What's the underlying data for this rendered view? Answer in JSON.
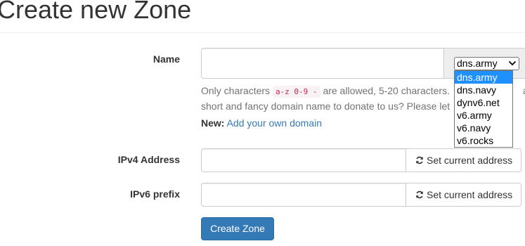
{
  "page": {
    "title": "Create new Zone"
  },
  "form": {
    "name": {
      "label": "Name",
      "value": "",
      "placeholder": "",
      "selected_domain": "dns.army",
      "domain_options": [
        "dns.army",
        "dns.navy",
        "dynv6.net",
        "v6.army",
        "v6.navy",
        "v6.rocks"
      ],
      "highlighted_option": "dns.army",
      "help_prefix": "Only characters",
      "help_code": "a-z 0-9 -",
      "help_suffix": "are allowed, 5-20 characters.",
      "help_line2": "short and fancy domain name to donate to us? Please let",
      "help_trailing": "a",
      "new_label": "New:",
      "new_link": "Add your own domain"
    },
    "ipv4": {
      "label": "IPv4 Address",
      "value": "",
      "button_label": "Set current address"
    },
    "ipv6": {
      "label": "IPv6 prefix",
      "value": "",
      "button_label": "Set current address"
    },
    "submit_label": "Create Zone"
  },
  "icons": {
    "refresh": "refresh-icon",
    "chevron": "chevron-down-icon"
  },
  "colors": {
    "primary": "#337ab7",
    "link": "#337ab7",
    "code_text": "#c7254e",
    "option_highlight": "#1e90ff"
  }
}
